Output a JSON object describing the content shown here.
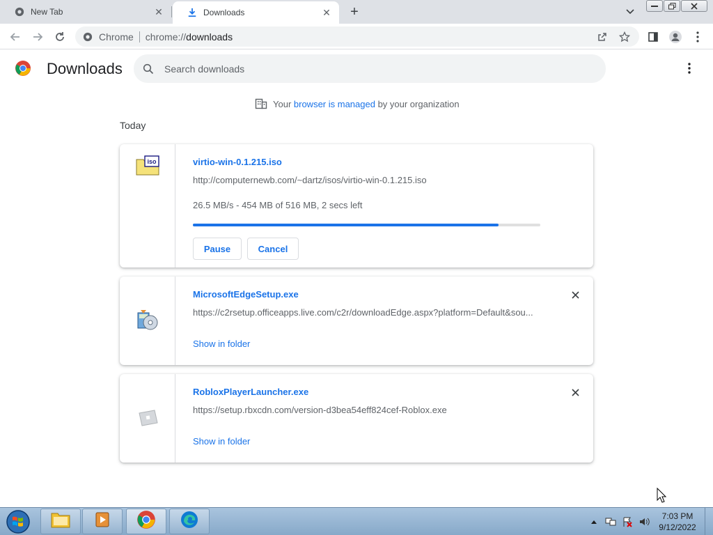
{
  "tabs": [
    {
      "title": "New Tab",
      "active": false
    },
    {
      "title": "Downloads",
      "active": true
    }
  ],
  "toolbar": {
    "site_label": "Chrome",
    "url_scheme": "chrome://",
    "url_path": "downloads"
  },
  "page": {
    "title": "Downloads",
    "search_placeholder": "Search downloads"
  },
  "managed": {
    "prefix": "Your ",
    "link": "browser is managed",
    "suffix": " by your organization"
  },
  "section": "Today",
  "downloads": [
    {
      "filename": "virtio-win-0.1.215.iso",
      "url": "http://computernewb.com/~dartz/isos/virtio-win-0.1.215.iso",
      "status": "26.5 MB/s - 454 MB of 516 MB, 2 secs left",
      "progress": 0.88,
      "pause_label": "Pause",
      "cancel_label": "Cancel"
    },
    {
      "filename": "MicrosoftEdgeSetup.exe",
      "url": "https://c2rsetup.officeapps.live.com/c2r/downloadEdge.aspx?platform=Default&sou...",
      "link_label": "Show in folder"
    },
    {
      "filename": "RobloxPlayerLauncher.exe",
      "url": "https://setup.rbxcdn.com/version-d3bea54eff824cef-Roblox.exe",
      "link_label": "Show in folder"
    }
  ],
  "taskbar": {
    "time": "7:03 PM",
    "date": "9/12/2022"
  },
  "colors": {
    "accent": "#1a73e8",
    "tabstrip": "#dee1e6"
  }
}
